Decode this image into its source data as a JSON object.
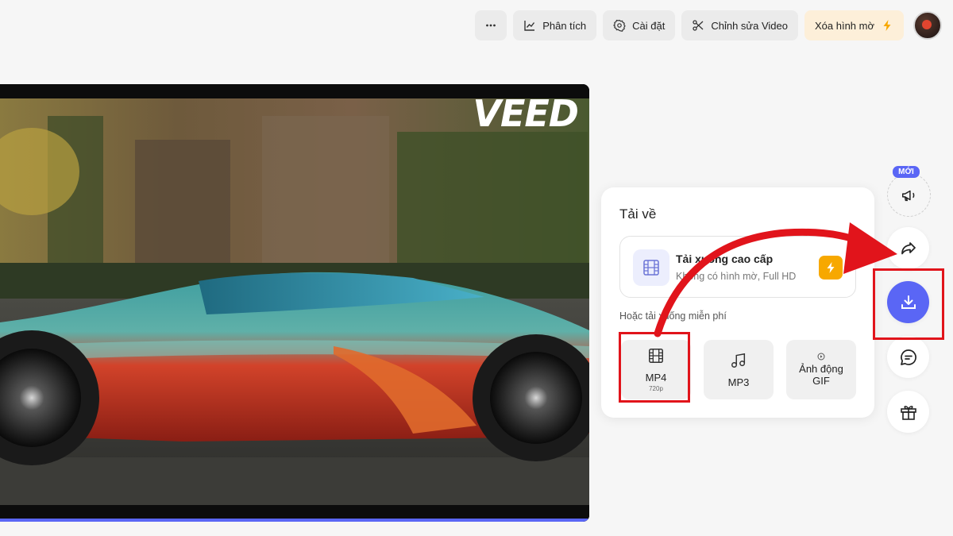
{
  "toolbar": {
    "more_icon": "more-horizontal-icon",
    "analytics_label": "Phân tích",
    "settings_label": "Cài đặt",
    "edit_label": "Chỉnh sửa Video",
    "upgrade_label": "Xóa hình mờ"
  },
  "video": {
    "watermark": "VEED"
  },
  "download_panel": {
    "title": "Tải về",
    "hq_title": "Tải xuống cao cấp",
    "hq_subtitle": "Không có hình mờ, Full HD",
    "free_label": "Hoặc tải xuống miễn phí",
    "formats": [
      {
        "name": "MP4",
        "sub": "720p",
        "icon": "film-icon"
      },
      {
        "name": "MP3",
        "sub": "",
        "icon": "music-note-icon"
      },
      {
        "name": "Ảnh động GIF",
        "sub": "",
        "icon": "gif-icon"
      }
    ]
  },
  "side_actions": {
    "new_badge": "MỚI",
    "items": [
      "megaphone-icon",
      "share-icon",
      "download-icon",
      "comment-icon",
      "gift-icon"
    ]
  },
  "colors": {
    "accent": "#5a66f5",
    "highlight_red": "#e1141b",
    "premium_orange": "#f7a800"
  }
}
